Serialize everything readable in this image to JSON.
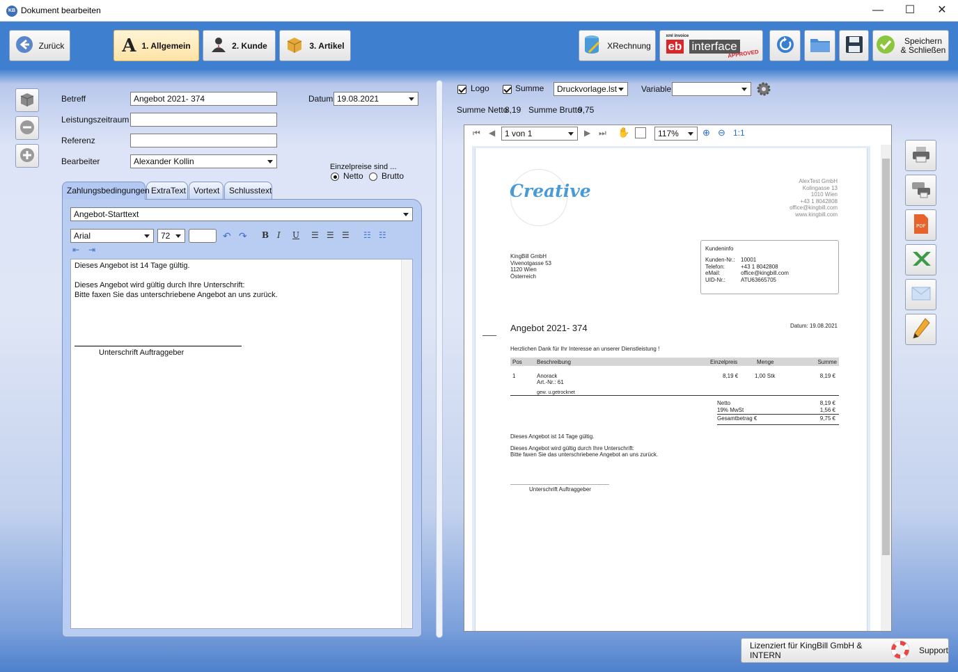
{
  "window": {
    "title": "Dokument bearbeiten",
    "app_icon": "KB",
    "min_glyph": "—",
    "max_glyph": "☐",
    "close_glyph": "✕"
  },
  "toolbar": {
    "back_label": "Zurück",
    "tab1_label": "1. Allgemein",
    "tab2_label": "2. Kunde",
    "tab3_label": "3. Artikel",
    "xrechnung_label": "XRechnung",
    "ebinterface_small": "xml invoice",
    "ebinterface_eb": "eb",
    "ebinterface_text": "interface",
    "ebinterface_approved": "APPROVED",
    "save_close_line1": "Speichern",
    "save_close_line2": "& Schließen"
  },
  "form": {
    "betreff_label": "Betreff",
    "betreff_value": "Angebot 2021- 374",
    "leistungszeitraum_label": "Leistungszeitraum",
    "leistungszeitraum_value": "",
    "referenz_label": "Referenz",
    "referenz_value": "",
    "bearbeiter_label": "Bearbeiter",
    "bearbeiter_value": "Alexander Kollin",
    "datum_label": "Datum",
    "datum_value": "19.08.2021",
    "einzelpreise_label": "Einzelpreise sind ...",
    "netto_label": "Netto",
    "brutto_label": "Brutto",
    "price_mode": "Netto"
  },
  "tabs": [
    {
      "label": "Zahlungsbedingungen",
      "active": true
    },
    {
      "label": "ExtraText",
      "active": false
    },
    {
      "label": "Vortext",
      "active": false
    },
    {
      "label": "Schlusstext",
      "active": false
    }
  ],
  "editor": {
    "template_value": "Angebot-Starttext",
    "font_value": "Arial",
    "size_value": "72",
    "color_value": "",
    "line1": "Dieses Angebot ist 14 Tage gültig.",
    "line2": "Dieses Angebot wird gültig durch Ihre Unterschrift:",
    "line3": "Bitte faxen Sie das unterschriebene Angebot an uns zurück.",
    "signature_label": "Unterschrift Auftraggeber"
  },
  "preview": {
    "logo_label": "Logo",
    "summe_label": "Summe",
    "druckvorlage_value": "Druckvorlage.lst",
    "variable_label": "Variable",
    "variable_value": "",
    "summe_netto_label": "Summe Netto",
    "summe_netto_value": "8,19",
    "summe_brutto_label": "Summe Brutto",
    "summe_brutto_value": "9,75",
    "page_value": "1 von 1",
    "zoom_value": "117%",
    "one_to_one": "1:1"
  },
  "document": {
    "logo_text": "Creative",
    "sender_lines": [
      "AlexTest GmbH",
      "Kolingasse 13",
      "1010 Wien",
      "+43 1 8042808",
      "office@kingbill.com",
      "www.kingbill.com"
    ],
    "recipient_lines": [
      "KingBill GmbH",
      "Vivenotgasse 53",
      "1120 Wien",
      "Österreich"
    ],
    "kundeninfo_title": "Kundeninfo",
    "kundeninfo_rows": [
      {
        "label": "Kunden-Nr.:",
        "value": "10001"
      },
      {
        "label": "Telefon:",
        "value": "+43 1 8042808"
      },
      {
        "label": "eMail:",
        "value": "office@kingbill.com"
      },
      {
        "label": "UID-Nr.:",
        "value": "ATU63665705"
      }
    ],
    "title": "Angebot 2021- 374",
    "date": "Datum: 19.08.2021",
    "intro": "Herzlichen Dank für Ihr Interesse an unserer Dienstleistung !",
    "table_headers": {
      "pos": "Pos",
      "beschreibung": "Beschreibung",
      "einzelpreis": "Einzelpreis",
      "menge": "Menge",
      "summe": "Summe"
    },
    "item": {
      "pos": "1",
      "name": "Anorack",
      "artnr": "Art.-Nr.: 61",
      "einzelpreis": "8,19 €",
      "menge": "1,00 Stk",
      "summe": "8,19 €",
      "note": "gew. u.getrocknet"
    },
    "totals": [
      {
        "label": "Netto",
        "value": "8,19 €"
      },
      {
        "label": "19% MwSt",
        "value": "1,56 €"
      },
      {
        "label": "Gesamtbetrag €",
        "value": "9,75 €"
      }
    ],
    "footer1": "Dieses Angebot ist 14 Tage gültig.",
    "footer2": "Dieses Angebot wird gültig durch Ihre Unterschrift:",
    "footer3": "Bitte faxen Sie das unterschriebene Angebot an uns zurück.",
    "signature_line": "-----------------------------------------------------------------------",
    "signature_label": "Unterschrift Auftraggeber"
  },
  "status": {
    "license_text": "Lizenziert für KingBill GmbH & INTERN",
    "support_label": "Support"
  },
  "colors": {
    "accent_blue": "#3e7fd0",
    "panel_blue": "#b9cdf3",
    "active_tab_yellow": "#fde3a6"
  }
}
